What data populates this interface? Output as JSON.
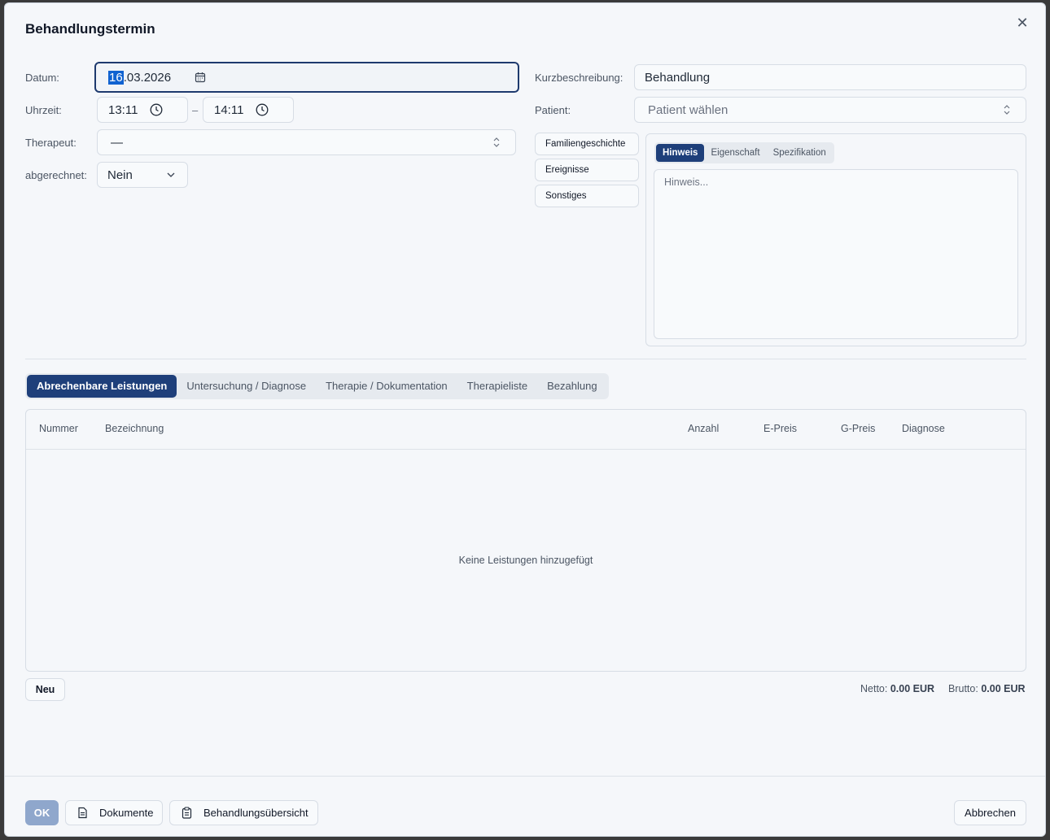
{
  "dialog": {
    "title": "Behandlungstermin",
    "close_glyph": "✕"
  },
  "form": {
    "datum_label": "Datum:",
    "datum_day": "16",
    "datum_rest": ".03.2026",
    "uhrzeit_label": "Uhrzeit:",
    "time_from": "13:11",
    "time_sep": "–",
    "time_to": "14:11",
    "therapeut_label": "Therapeut:",
    "therapeut_value": "—",
    "abgerechnet_label": "abgerechnet:",
    "abgerechnet_value": "Nein",
    "kurz_label": "Kurzbeschreibung:",
    "kurz_value": "Behandlung",
    "patient_label": "Patient:",
    "patient_placeholder": "Patient wählen"
  },
  "side_buttons": [
    "Familiengeschichte",
    "Ereignisse",
    "Sonstiges"
  ],
  "note_tabs": [
    {
      "label": "Hinweis",
      "active": true
    },
    {
      "label": "Eigenschaft",
      "active": false
    },
    {
      "label": "Spezifikation",
      "active": false
    }
  ],
  "note_placeholder": "Hinweis...",
  "main_tabs": [
    {
      "label": "Abrechenbare Leistungen",
      "active": true
    },
    {
      "label": "Untersuchung / Diagnose",
      "active": false
    },
    {
      "label": "Therapie / Dokumentation",
      "active": false
    },
    {
      "label": "Therapieliste",
      "active": false
    },
    {
      "label": "Bezahlung",
      "active": false
    }
  ],
  "table": {
    "columns": [
      "Nummer",
      "Bezeichnung",
      "Anzahl",
      "E-Preis",
      "G-Preis",
      "Diagnose"
    ],
    "empty_text": "Keine Leistungen hinzugefügt"
  },
  "neu_label": "Neu",
  "totals": {
    "netto_label": "Netto:",
    "netto_value": "0.00 EUR",
    "brutto_label": "Brutto:",
    "brutto_value": "0.00 EUR"
  },
  "footer": {
    "ok": "OK",
    "dokumente": "Dokumente",
    "uebersicht": "Behandlungsübersicht",
    "abbrechen": "Abbrechen"
  },
  "icons": {
    "calendar": "calendar-icon",
    "clock": "clock-icon",
    "chevron_updown": "chevron-updown-icon",
    "chevron_down": "chevron-down-icon",
    "document": "document-icon",
    "clipboard": "clipboard-icon"
  },
  "colors": {
    "primary": "#1e3f7a",
    "ok_disabled": "#8fa7cc",
    "selection": "#0f62d1"
  }
}
